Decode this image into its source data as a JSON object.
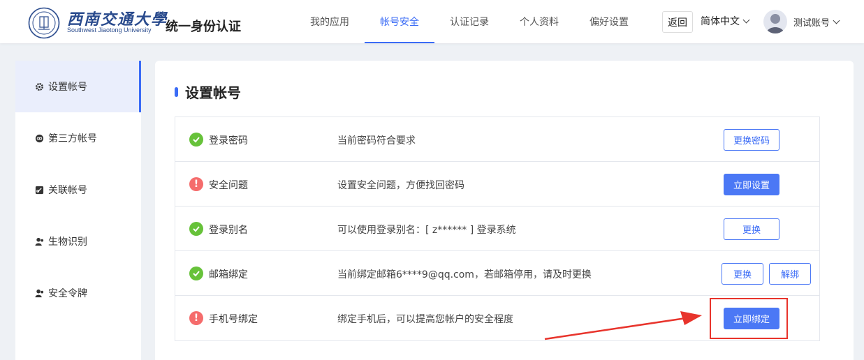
{
  "header": {
    "logo_cn": "西南交通大學",
    "logo_en": "Southwest Jiaotong University",
    "app_title": "统一身份认证",
    "nav": [
      {
        "label": "我的应用",
        "active": false
      },
      {
        "label": "帐号安全",
        "active": true
      },
      {
        "label": "认证记录",
        "active": false
      },
      {
        "label": "个人资料",
        "active": false
      },
      {
        "label": "偏好设置",
        "active": false
      }
    ],
    "back_label": "返回",
    "language": "简体中文",
    "username": "测试账号"
  },
  "sidebar": {
    "items": [
      {
        "label": "设置帐号",
        "icon": "gear-icon",
        "active": true
      },
      {
        "label": "第三方帐号",
        "icon": "link-icon",
        "active": false
      },
      {
        "label": "关联帐号",
        "icon": "link-card-icon",
        "active": false
      },
      {
        "label": "生物识别",
        "icon": "user-icon",
        "active": false
      },
      {
        "label": "安全令牌",
        "icon": "users-icon",
        "active": false
      }
    ]
  },
  "main": {
    "title": "设置帐号",
    "rows": [
      {
        "name": "登录密码",
        "status": "ok",
        "desc": "当前密码符合要求",
        "buttons": [
          {
            "label": "更换密码",
            "style": "outline"
          }
        ]
      },
      {
        "name": "安全问题",
        "status": "warn",
        "desc": "设置安全问题，方便找回密码",
        "buttons": [
          {
            "label": "立即设置",
            "style": "primary"
          }
        ]
      },
      {
        "name": "登录别名",
        "status": "ok",
        "desc": "可以使用登录别名：[ z****** ] 登录系统",
        "buttons": [
          {
            "label": "更换",
            "style": "outline"
          }
        ]
      },
      {
        "name": "邮箱绑定",
        "status": "ok",
        "desc": "当前绑定邮箱6****9@qq.com，若邮箱停用，请及时更换",
        "buttons": [
          {
            "label": "更换",
            "style": "outline"
          },
          {
            "label": "解绑",
            "style": "outline"
          }
        ]
      },
      {
        "name": "手机号绑定",
        "status": "warn",
        "desc": "绑定手机后，可以提高您帐户的安全程度",
        "buttons": [
          {
            "label": "立即绑定",
            "style": "primary"
          }
        ]
      }
    ]
  },
  "colors": {
    "accent": "#3b6cf6",
    "ok": "#67c23a",
    "warn": "#f56c6c",
    "annotation": "#e8342c"
  }
}
